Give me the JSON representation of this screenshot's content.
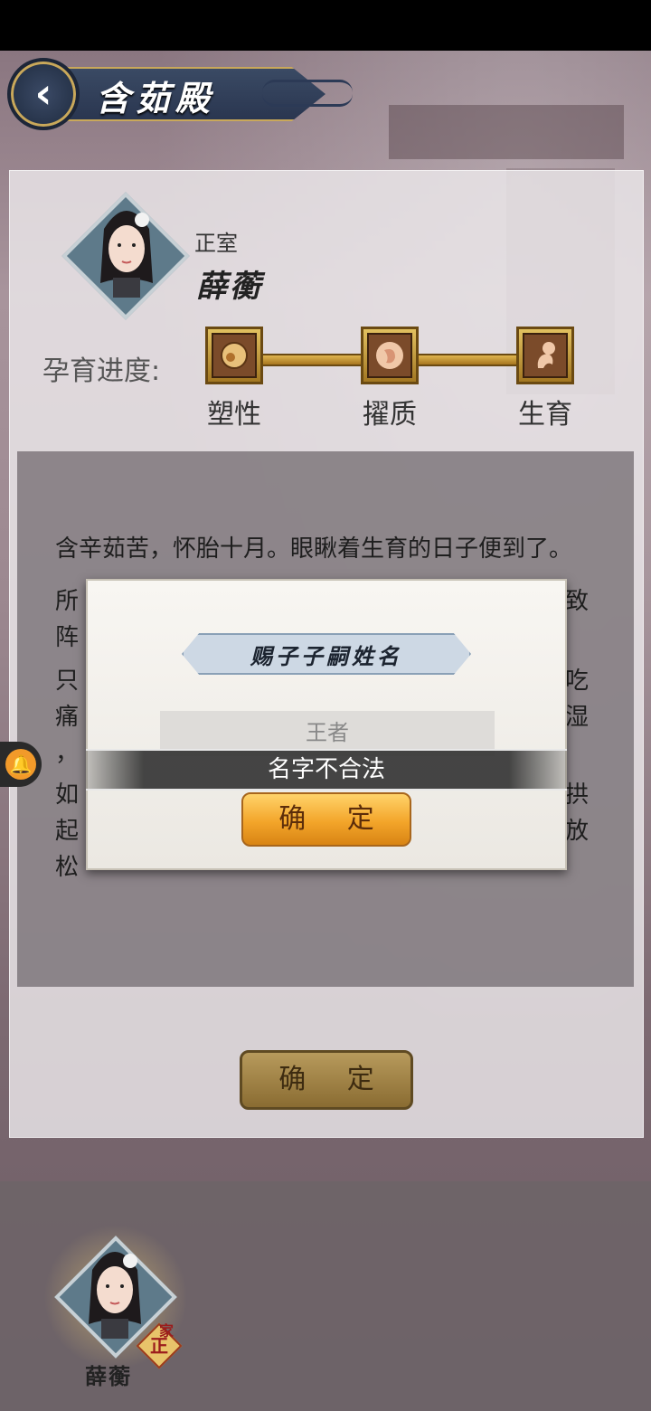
{
  "header": {
    "title": "含茹殿",
    "back_icon": "‹"
  },
  "consort": {
    "rank": "正室",
    "name": "薛蘅"
  },
  "progress": {
    "label": "孕育进度:",
    "stages": [
      "塑性",
      "擢质",
      "生育"
    ],
    "completed_stages": 3
  },
  "story": {
    "paragraphs": [
      "含辛茹苦，怀胎十月。眼瞅着生育的日子便到了。",
      "所",
      "阵",
      "只",
      "痛",
      "，",
      "如",
      "起",
      "松"
    ],
    "right_fragments": [
      "致",
      "吃",
      "湿",
      "拱",
      "放"
    ]
  },
  "main_confirm_label": "确 定",
  "modal": {
    "title": "赐子子嗣姓名",
    "input_value": "王者",
    "confirm_label": "确 定"
  },
  "toast": "名字不合法",
  "bottom": {
    "name": "薛蘅",
    "badge_top": "家",
    "badge": "正"
  },
  "colors": {
    "gold": "#c9a85a",
    "navy": "#2a3650",
    "button_orange": "#f3a52a"
  }
}
